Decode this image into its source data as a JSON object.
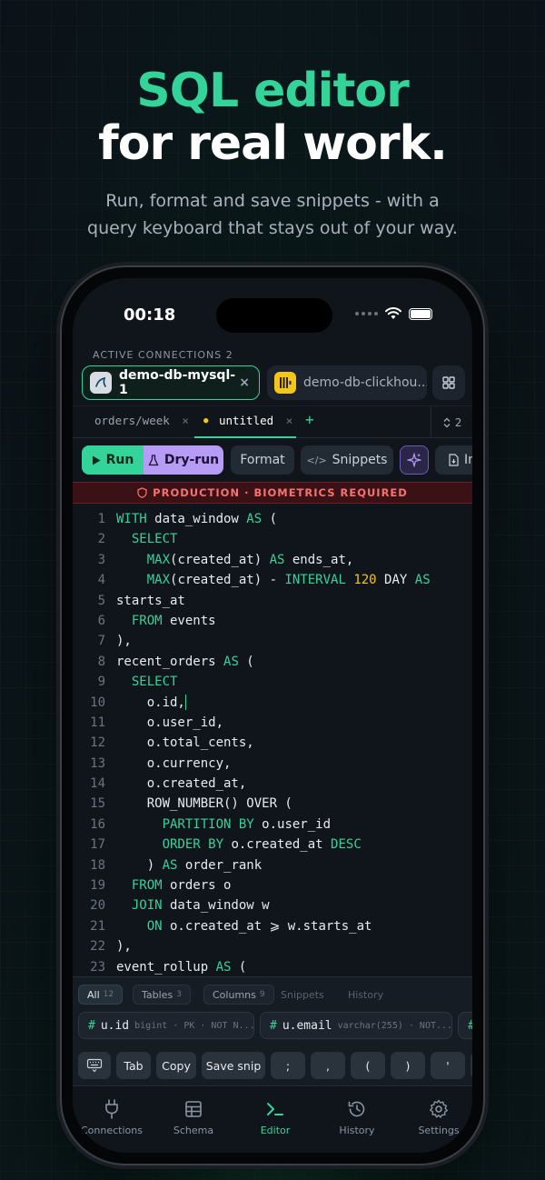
{
  "hero": {
    "line1": "SQL editor",
    "line2": "for real work.",
    "sub1": "Run, format and save snippets - with a",
    "sub2": "query keyboard that stays out of your way."
  },
  "status": {
    "time": "00:18"
  },
  "connections": {
    "label": "ACTIVE CONNECTIONS 2",
    "items": [
      {
        "name": "demo-db-mysql-1",
        "close": "×"
      },
      {
        "name": "demo-db-clickhou..."
      }
    ]
  },
  "tabs": {
    "items": [
      {
        "label": "orders/week",
        "close": "×"
      },
      {
        "label": "untitled",
        "close": "×",
        "dot": "●"
      }
    ],
    "add": "+",
    "count": "2"
  },
  "toolbar": {
    "run": "Run",
    "dry_run": "Dry-run",
    "format": "Format",
    "snippets": "Snippets",
    "import": "Im"
  },
  "banner": {
    "text": "PRODUCTION · BIOMETRICS REQUIRED"
  },
  "autocomplete": {
    "filters": [
      {
        "label": "All",
        "count": "12"
      },
      {
        "label": "Tables",
        "count": "3"
      },
      {
        "label": "Columns",
        "count": "9"
      },
      {
        "label": "Snippets"
      },
      {
        "label": "History"
      }
    ],
    "suggestions": [
      {
        "hash": "#",
        "name": "u.id",
        "meta": "bigint · PK · NOT N..."
      },
      {
        "hash": "#",
        "name": "u.email",
        "meta": "varchar(255) · NOT..."
      },
      {
        "hash": "#"
      }
    ]
  },
  "keys": {
    "tab": "Tab",
    "copy": "Copy",
    "save": "Save snip",
    "semi": ";",
    "comma": ",",
    "lparen": "(",
    "rparen": ")",
    "quote": "'",
    "dquote": "\""
  },
  "nav": {
    "items": [
      {
        "label": "Connections",
        "icon": "plug-icon"
      },
      {
        "label": "Schema",
        "icon": "table-icon"
      },
      {
        "label": "Editor",
        "icon": "terminal-icon",
        "active": true
      },
      {
        "label": "History",
        "icon": "history-icon"
      },
      {
        "label": "Settings",
        "icon": "gear-icon"
      }
    ]
  },
  "colors": {
    "accent": "#34d399",
    "dryrun": "#b79cf5",
    "danger": "#f87171",
    "number": "#f5c518"
  }
}
